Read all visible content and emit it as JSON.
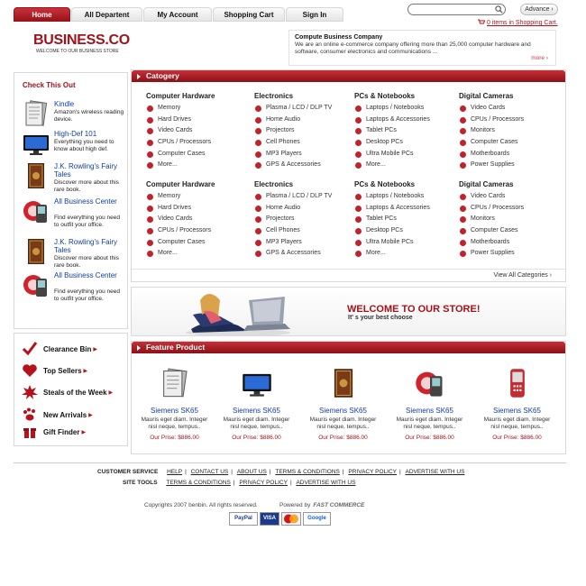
{
  "nav": {
    "tabs": [
      "Home",
      "All Departent",
      "My Account",
      "Shopping Cart",
      "Sign In"
    ]
  },
  "search": {
    "placeholder": "",
    "advance_label": "Advance ›"
  },
  "cart": {
    "text": "0 items in Shopping Cart."
  },
  "brand": {
    "logo": "BUSINESS.CO",
    "tagline": "WELCOME TO OUR BUSINESS STORE"
  },
  "company": {
    "title": "Compute Business Company",
    "text": "We are an online e-commerce company offering more than 25,000 computer hardware and software, consumer electronics and communications ...",
    "more": "more ›"
  },
  "check": {
    "title": "Check This Out",
    "items": [
      {
        "title": "Kindle",
        "desc": "Amazon's wireless reading device.",
        "icon": "kindle-icon"
      },
      {
        "title": "High-Def 101",
        "desc": "Everything you need to know about high def.",
        "icon": "tv-icon"
      },
      {
        "title": "J.K. Rowling's Fairy Tales",
        "desc": "Discover more about this rare book.",
        "icon": "book-icon"
      },
      {
        "title": "All Business Center",
        "desc": "Find everything you need to outfit your office.",
        "icon": "phone-icon"
      },
      {
        "title": "J.K. Rowling's Fairy Tales",
        "desc": "Discover more about this rare book.",
        "icon": "book-icon"
      },
      {
        "title": "All Business Center",
        "desc": "Find everything you need to outfit your office.",
        "icon": "phone-icon"
      }
    ]
  },
  "quick": {
    "items": [
      "Clearance Bin",
      "Top Sellers",
      "Steals of the Week",
      "New Arrivals",
      "Gift Finder"
    ]
  },
  "category": {
    "title": "Catogery",
    "view_all": "View All Categories",
    "groups": [
      {
        "title": "Computer Hardware",
        "items": [
          "Memory",
          "Hard Drives",
          "Video Cards",
          "CPUs / Processors",
          "Computer Cases",
          "More..."
        ]
      },
      {
        "title": "Electronics",
        "items": [
          "Plasma / LCD / DLP TV",
          "Home Audio",
          "Projectors",
          "Cell Phones",
          "MP3 Players",
          "GPS & Accessories"
        ]
      },
      {
        "title": "PCs & Notebooks",
        "items": [
          "Laptops / Notebooks",
          "Laptops & Accessories",
          "Tablet PCs",
          "Desktop PCs",
          "Ultra Mobile PCs",
          "More..."
        ]
      },
      {
        "title": "Digital Cameras",
        "items": [
          "Video Cards",
          "CPUs / Processors",
          "Monitors",
          "Computer Cases",
          "Motherboards",
          "Power Supplies"
        ]
      },
      {
        "title": "Computer Hardware",
        "items": [
          "Memory",
          "Hard Drives",
          "Video Cards",
          "CPUs / Processors",
          "Computer Cases",
          "More..."
        ]
      },
      {
        "title": "Electronics",
        "items": [
          "Plasma / LCD / DLP TV",
          "Home Audio",
          "Projectors",
          "Cell Phones",
          "MP3 Players",
          "GPS & Accessories"
        ]
      },
      {
        "title": "PCs & Notebooks",
        "items": [
          "Laptops / Notebooks",
          "Laptops & Accessories",
          "Tablet PCs",
          "Desktop PCs",
          "Ultra Mobile PCs",
          "More..."
        ]
      },
      {
        "title": "Digital Cameras",
        "items": [
          "Video Cards",
          "CPUs / Processors",
          "Monitors",
          "Computer Cases",
          "Motherboards",
          "Power Supplies"
        ]
      }
    ]
  },
  "welcome": {
    "title": "WELCOME TO OUR STORE!",
    "subtitle": "It' s your best choose"
  },
  "featured": {
    "title": "Feature Product",
    "items": [
      {
        "name": "Siemens SK65",
        "desc": "Mauris eget diam. Integer nisl neque, tempus..",
        "price": "Our Prise: $886.00",
        "icon": "kindle-icon"
      },
      {
        "name": "Siemens SK65",
        "desc": "Mauris eget diam. Integer nisl neque, tempus..",
        "price": "Our Prise: $886.00",
        "icon": "tv-icon"
      },
      {
        "name": "Siemens SK65",
        "desc": "Mauris eget diam. Integer nisl neque, tempus..",
        "price": "Our Prise: $886.00",
        "icon": "book-icon"
      },
      {
        "name": "Siemens SK65",
        "desc": "Mauris eget diam. Integer nisl neque, tempus..",
        "price": "Our Prise: $886.00",
        "icon": "phone-icon"
      },
      {
        "name": "Siemens SK65",
        "desc": "Mauris eget diam. Integer nisl neque, tempus..",
        "price": "Our Prise: $886.00",
        "icon": "mobile-phone-icon"
      }
    ]
  },
  "footer": {
    "customer_service_label": "CUSTOMER SERVICE",
    "customer_service_links": [
      "HELP",
      "CONTACT US",
      "ABOUT US",
      "TERMS & CONDITIONS",
      "PRIVACY POLICY",
      "ADVERTISE WITH US"
    ],
    "site_tools_label": "SITE TOOLS",
    "site_tools_links": [
      "TERMS & CONDITIONS",
      "PRIVACY POLICY",
      "ADVERTISE WITH US"
    ],
    "copyright": "Copyrights 2007 benbin. All rights reserved.",
    "powered_by": "Powered by",
    "powered_brand": "FAST COMMERCE",
    "payment": [
      "PayPal",
      "VISA",
      "MasterCard",
      "Google"
    ]
  },
  "colors": {
    "accent": "#a3121a",
    "link": "#113ea4"
  }
}
